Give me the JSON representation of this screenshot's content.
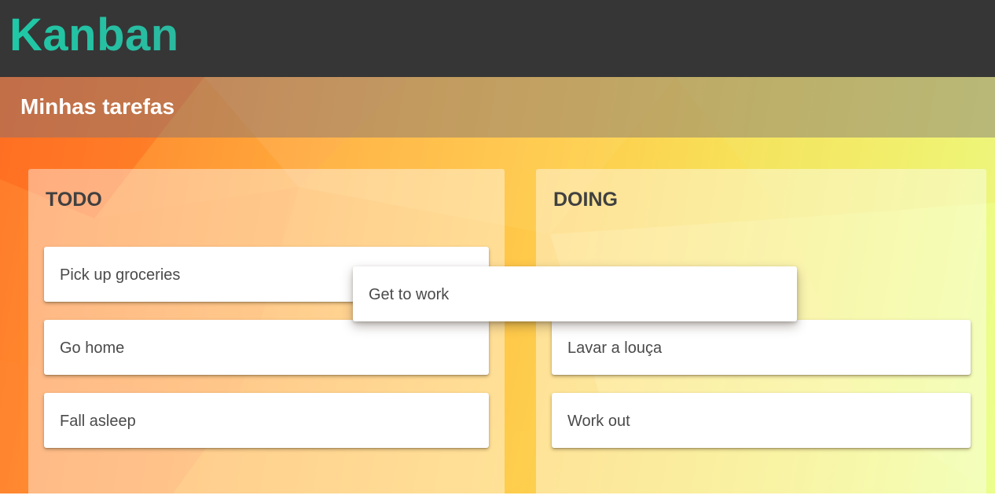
{
  "app": {
    "title": "Kanban"
  },
  "board": {
    "title": "Minhas tarefas"
  },
  "columns": [
    {
      "title": "TODO",
      "cards": [
        "Pick up groceries",
        "Go home",
        "Fall asleep"
      ]
    },
    {
      "title": "DOING",
      "cards": [
        "Lavar a louça",
        "Work out"
      ]
    }
  ],
  "dragging_card": {
    "text": "Get to work"
  },
  "colors": {
    "topbar": "#363636",
    "logo_accent": "#1fc8a6",
    "card_text": "#4a4a4a",
    "column_title": "#404040"
  }
}
